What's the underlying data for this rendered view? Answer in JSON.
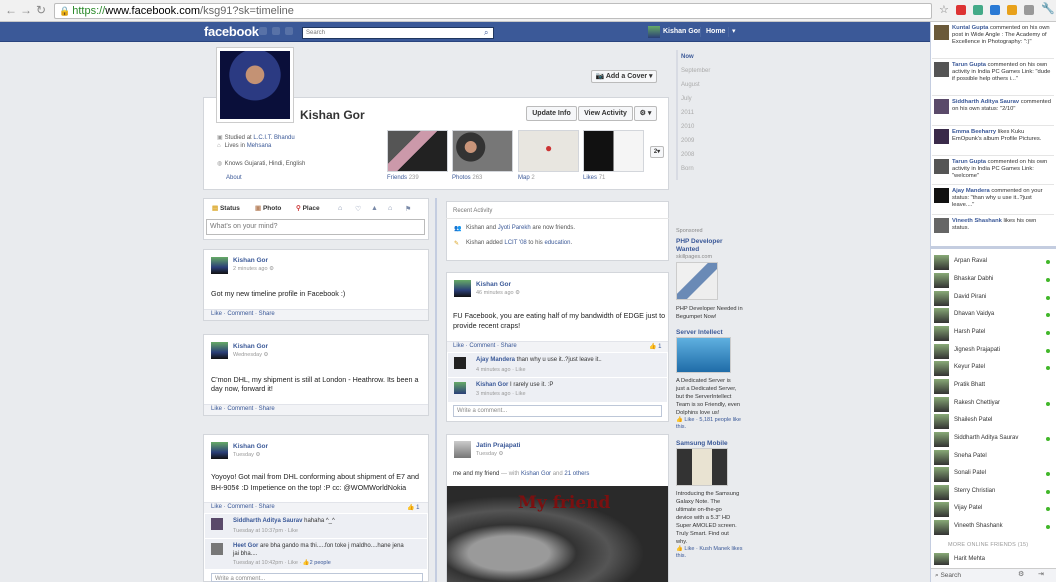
{
  "browser": {
    "url_scheme": "https://",
    "url_host": "www.facebook.com",
    "url_path": "/ksg91?sk=timeline"
  },
  "topbar": {
    "logo": "facebook",
    "search_placeholder": "Search",
    "user_name": "Kishan Gor",
    "home": "Home"
  },
  "profile": {
    "name": "Kishan Gor",
    "add_cover": "Add a Cover",
    "update_info": "Update Info",
    "view_activity": "View Activity",
    "studied_prefix": "Studied at",
    "studied_link": "L.C.I.T. Bhandu",
    "lives_prefix": "Lives in",
    "lives_link": "Mehsana",
    "knows": "Knows Gujarati, Hindi, English",
    "about": "About",
    "thumbs": [
      {
        "label": "Friends",
        "count": "239"
      },
      {
        "label": "Photos",
        "count": "263"
      },
      {
        "label": "Map",
        "count": "2"
      },
      {
        "label": "Likes",
        "count": "71"
      }
    ],
    "more_count": "2"
  },
  "timeline_nav": [
    "Now",
    "September",
    "August",
    "July",
    "2011",
    "2010",
    "2009",
    "2008",
    "Born"
  ],
  "composer": {
    "status": "Status",
    "photo": "Photo",
    "place": "Place",
    "placeholder": "What's on your mind?"
  },
  "recent": {
    "title": "Recent Activity",
    "line1_a": "Kishan",
    "line1_b": " and ",
    "line1_c": "Jyoti Parekh",
    "line1_d": " are now friends.",
    "line2_a": "Kishan added ",
    "line2_b": "LCIT '08",
    "line2_c": " to his ",
    "line2_d": "education",
    "line2_e": "."
  },
  "posts": {
    "p1": {
      "name": "Kishan Gor",
      "time": "2 minutes ago",
      "text": "Got my new timeline profile in Facebook :)",
      "foot": "Like · Comment · Share"
    },
    "p2": {
      "name": "Kishan Gor",
      "time": "Wednesday",
      "text1": "C'mon DHL, my shipment is still at London - Heathrow. Its been a",
      "text2": "day now, forward it!",
      "foot": "Like · Comment · Share"
    },
    "p3": {
      "name": "Kishan Gor",
      "time": "Tuesday",
      "text1": "Yoyoyo! Got mail from DHL conforming about shipment of E7 and",
      "text2": "BH-905¢ :D Impetience on the top! :P cc: @WOMWorldNokia",
      "foot": "Like · Comment · Share",
      "likes": "1",
      "c1_name": "Siddharth Aditya Saurav",
      "c1_text": " hahaha ^_^",
      "c1_meta": "Tuesday at 10:37pm · Like",
      "c2_name": "Heet Gor",
      "c2_text": " are bha gando ma thi.....fon toke j maldho....hane jena",
      "c2_text2": "jai bha....",
      "c2_meta": "Tuesday at 10:42pm · Like · ",
      "c2_likes": "2 people",
      "write": "Write a comment..."
    },
    "p4": {
      "name": "Kishan Gor",
      "time": "46 minutes ago",
      "text1": "FU Facebook, you are eating half of my bandwidth of EDGE just to",
      "text2": "provide recent craps!",
      "foot": "Like · Comment · Share",
      "likes": "1",
      "c1_name": "Ajay Mandera",
      "c1_text": " than why u use it..?just leave it..",
      "c1_meta": "4 minutes ago · Like",
      "c2_name": "Kishan Gor",
      "c2_text": " I rarely use it. :P",
      "c2_meta": "3 minutes ago · Like",
      "write": "Write a comment..."
    },
    "p5": {
      "name": "Jatin Prajapati",
      "time": "Tuesday",
      "text_a": "me and my friend",
      "text_b": " — with ",
      "text_c": "Kishan Gor",
      "text_d": " and ",
      "text_e": "21 others",
      "photo_caption": "My friend"
    }
  },
  "sponsored": {
    "label": "Sponsored",
    "ads": [
      {
        "title1": "PHP Developer",
        "title2": "Wanted",
        "domain": "skillpages.com",
        "body": [
          "PHP Developer Needed in",
          "Begumpet Now!"
        ]
      },
      {
        "title1": "Server Intellect",
        "body": [
          "A Dedicated Server is",
          "just a Dedicated Server,",
          "but the ServerIntellect",
          "Team is so Friendly, even",
          "Dolphins love us!"
        ],
        "like": "Like · 5,181 people like",
        "like2": "this."
      },
      {
        "title1": "Samsung Mobile",
        "body": [
          "Introducing the Samsung",
          "Galaxy Note. The",
          "ultimate on-the-go",
          "device with a 5.3\" HD",
          "Super AMOLED screen.",
          "Truly Smart. Find out",
          "why."
        ],
        "like": "Like · Kush Manek likes",
        "like2": "this."
      }
    ]
  },
  "ticker": [
    {
      "name": "Kuntal Gupta",
      "text": " commented on his own post in Wide Angle : The Academy of Excellence in Photography: \":)\""
    },
    {
      "name": "Tarun Gupta",
      "text": " commented on his own activity in India PC Games Link: \"dude if possible help others i...\""
    },
    {
      "name": "Siddharth Aditya Saurav",
      "text": " commented on his own status: \"2/10\""
    },
    {
      "name": "Emma Beeharry",
      "text": " likes Kuku EmOpunk's album Profile Pictures."
    },
    {
      "name": "Tarun Gupta",
      "text": " commented on his own activity in India PC Games Link: \"welcome\""
    },
    {
      "name": "Ajay Mandera",
      "text": " commented on your status: \"than why u use it..?just leave....\""
    },
    {
      "name": "Vineeth Shashank",
      "text": " likes his own status."
    }
  ],
  "chat": {
    "friends": [
      "Arpan Raval",
      "Bhaskar Dabhi",
      "David Pirani",
      "Dhavan Vaidya",
      "Harsh Patel",
      "Jignesh Prajapati",
      "Keyur Patel",
      "Pratik Bhatt",
      "Rakesh Chettiyar",
      "Shailesh Patel",
      "Siddharth Aditya Saurav",
      "Sneha Patel",
      "Sonali Patel",
      "Sterry Christian",
      "Vijay Patel",
      "Vineeth Shashank"
    ],
    "more_online": "MORE ONLINE FRIENDS (15)",
    "last_friend": "Harit Mehta",
    "search": "Search"
  }
}
